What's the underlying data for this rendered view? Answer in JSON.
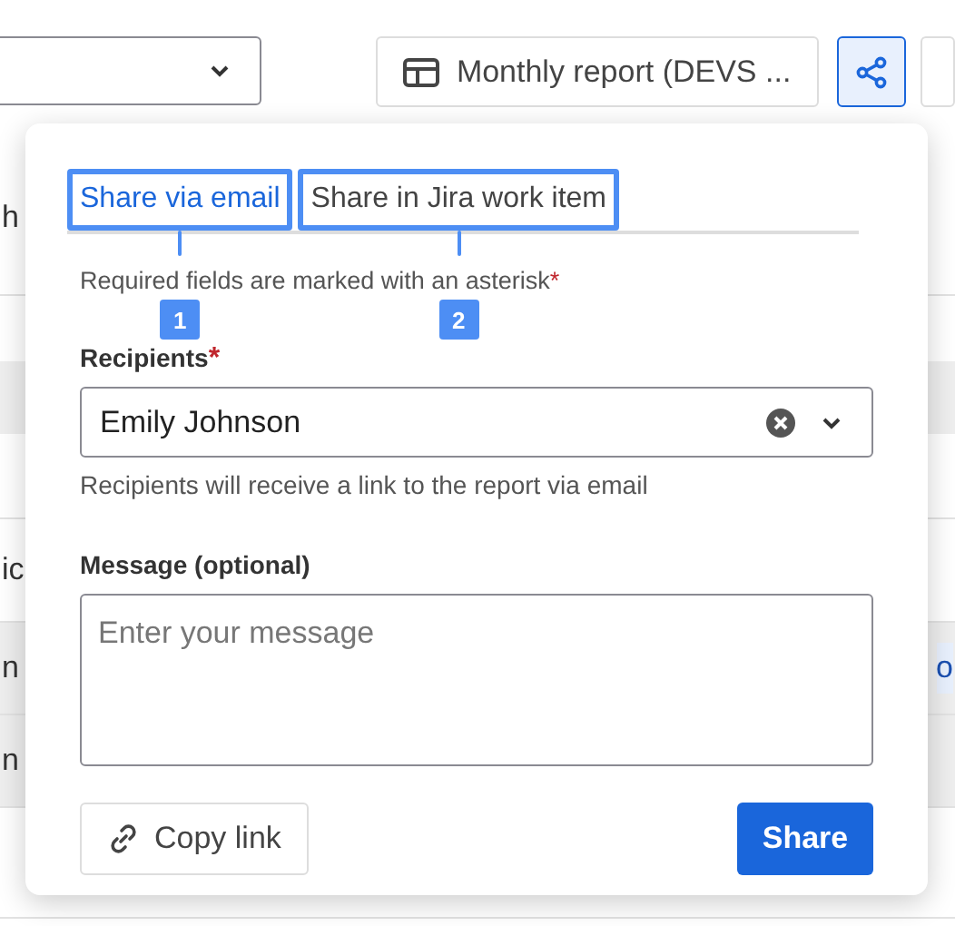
{
  "toolbar": {
    "report_button": {
      "label": "Monthly report (DEVS ..."
    },
    "share_button": {
      "selected": true
    }
  },
  "background_rows": [
    {
      "left": "h"
    },
    {},
    {
      "left": "ic"
    },
    {
      "left": "n",
      "right": "o"
    },
    {
      "left": "n"
    },
    {}
  ],
  "share_dialog": {
    "tabs": [
      {
        "label": "Share via email",
        "selected": true,
        "callout": "1"
      },
      {
        "label": "Share in Jira work item",
        "selected": false,
        "callout": "2"
      }
    ],
    "required_note": "Required fields are marked with an asterisk",
    "required_note_mark": "*",
    "recipients": {
      "label": "Recipients",
      "mark": "*",
      "value": "Emily Johnson",
      "help": "Recipients will receive a link to the report via email"
    },
    "message": {
      "label": "Message (optional)",
      "placeholder": "Enter your message"
    },
    "copy_link": "Copy link",
    "share": "Share"
  }
}
